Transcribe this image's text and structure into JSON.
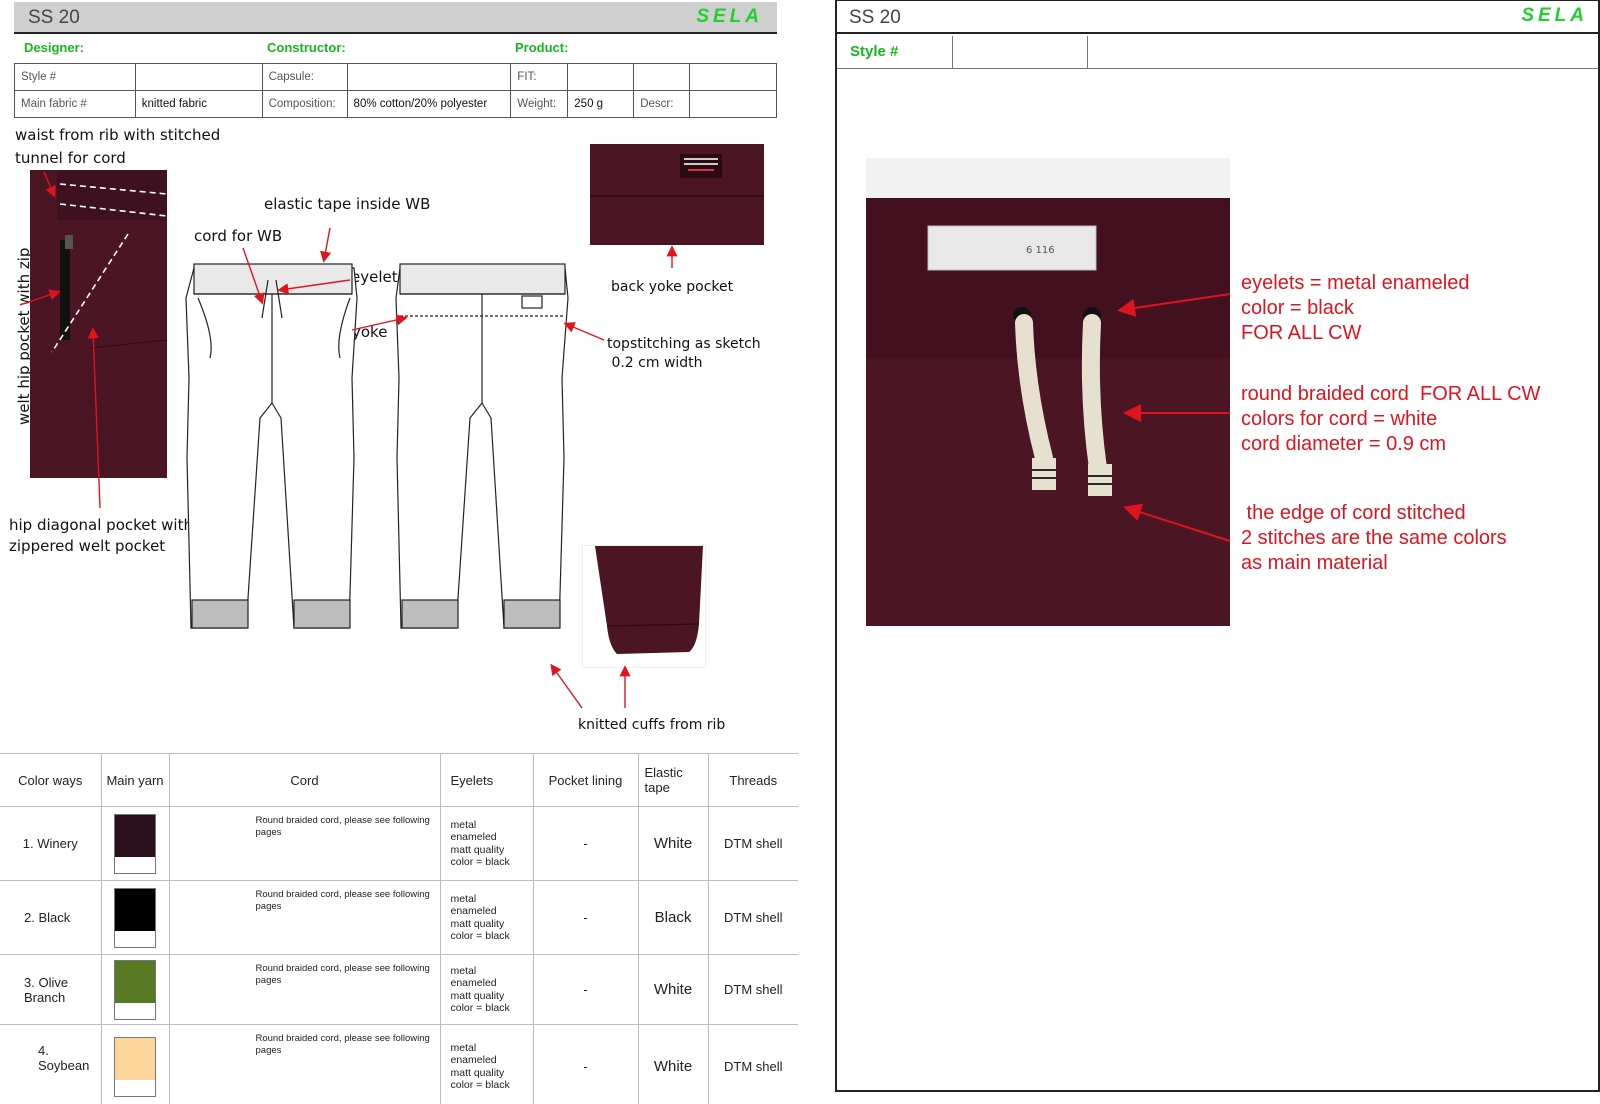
{
  "left": {
    "season": "SS 20",
    "brand": "SELA",
    "roles": {
      "designer": "Designer:",
      "constructor": "Constructor:",
      "product": "Product:"
    },
    "info_rows": [
      [
        "Style #",
        "",
        "Capsule:",
        "",
        "FIT:",
        "",
        "",
        ""
      ],
      [
        "Main fabric #",
        "knitted fabric",
        "Composition:",
        "80% cotton/20% polyester",
        "Weight:",
        "250 g",
        "Descr:",
        ""
      ]
    ],
    "callouts": {
      "waist": "waist from rib with stitched\ntunnel for cord",
      "welt_zip": "welt hip pocket with zip",
      "hip_pocket": "hip diagonal pocket with\nzippered welt pocket",
      "cord": "cord for WB",
      "elastic": "elastic tape inside WB",
      "eyelets": "eyelets",
      "yoke": "yoke",
      "back_yoke": "back yoke pocket",
      "topstitch": "topstitching as sketch\n 0.2 cm width",
      "cuffs": "knitted cuffs from rib"
    },
    "table": {
      "headers": [
        "Color ways",
        "Main yarn",
        "Cord",
        "Eyelets",
        "Pocket lining",
        "Elastic tape",
        "Threads"
      ],
      "rows": [
        {
          "name": "1. Winery",
          "color": "#2d0e1c",
          "cord": "Round braided cord, please see following pages",
          "eyelets": "metal\nenameled\nmatt quality\ncolor = black",
          "lining": "-",
          "tape": "White",
          "threads": "DTM shell"
        },
        {
          "name": "2. Black",
          "color": "#000000",
          "cord": "Round braided cord, please see following pages",
          "eyelets": "metal\nenameled\nmatt quality\ncolor = black",
          "lining": "-",
          "tape": "Black",
          "threads": "DTM shell"
        },
        {
          "name": "3. Olive Branch",
          "color": "#587a25",
          "cord": "Round braided cord, please see following pages",
          "eyelets": "metal\nenameled\nmatt quality\ncolor = black",
          "lining": "-",
          "tape": "White",
          "threads": "DTM shell"
        },
        {
          "name": "4. Soybean",
          "color": "#fdd49c",
          "cord": "Round braided cord, please see following pages",
          "eyelets": "metal\nenameled\nmatt quality\ncolor = black",
          "lining": "-",
          "tape": "White",
          "threads": "DTM shell"
        }
      ]
    }
  },
  "right": {
    "season": "SS 20",
    "brand": "SELA",
    "style_label": "Style #",
    "label_text": "6   116",
    "notes": {
      "eyelets": "eyelets = metal enameled\ncolor = black\nFOR ALL CW",
      "cord": "round braided cord  FOR ALL CW\ncolors for cord = white\ncord diameter = 0.9 cm",
      "edge": " the edge of cord stitched\n2 stitches are the same colors\nas main material"
    }
  },
  "colors": {
    "brand_green": "#1ed22a",
    "fabric": "#4b1524",
    "annotation_red": "#e0141e"
  }
}
